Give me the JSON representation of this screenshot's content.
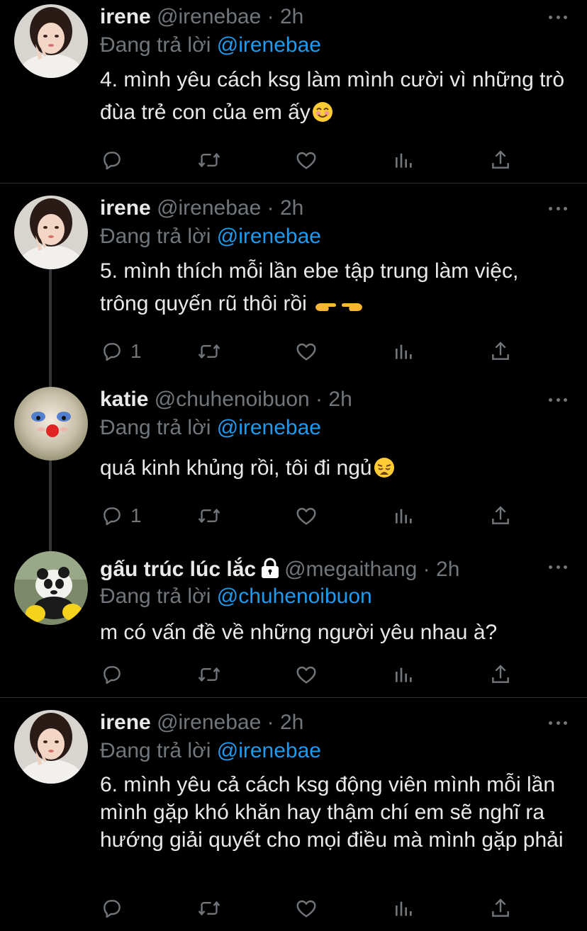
{
  "reply_prefix": "Đang trả lời",
  "tweets": [
    {
      "name": "irene",
      "handle": "@irenebae",
      "time": "2h",
      "reply_to": "@irenebae",
      "text": "4. mình yêu cách ksg làm mình cười vì những trò đùa trẻ con của em ấy",
      "emoji": "smiling-face-icon",
      "reply_count": "",
      "avatar": "irene-avatar"
    },
    {
      "name": "irene",
      "handle": "@irenebae",
      "time": "2h",
      "reply_to": "@irenebae",
      "text": "5. mình thích mỗi lần ebe tập trung làm việc, trông quyến rũ thôi rồi",
      "emoji": "pointing-hands-icon",
      "reply_count": "1",
      "avatar": "irene-avatar"
    },
    {
      "name": "katie",
      "handle": "@chuhenoibuon",
      "time": "2h",
      "reply_to": "@irenebae",
      "text": "quá kinh khủng rồi, tôi đi ngủ",
      "emoji": "weary-face-icon",
      "reply_count": "1",
      "avatar": "clown-dog-avatar"
    },
    {
      "name": "gấu trúc lúc lắc",
      "handle": "@megaithang",
      "time": "2h",
      "reply_to": "@chuhenoibuon",
      "text": "m có vấn đề về những người yêu nhau à?",
      "emoji": "",
      "reply_count": "",
      "avatar": "panda-avatar",
      "protected": true
    },
    {
      "name": "irene",
      "handle": "@irenebae",
      "time": "2h",
      "reply_to": "@irenebae",
      "text": "6. mình yêu cả cách ksg động viên mình mỗi lần mình gặp khó khăn hay thậm chí em sẽ nghĩ ra hướng giải quyết cho mọi điều mà mình gặp phải",
      "emoji": "",
      "reply_count": "",
      "avatar": "irene-avatar"
    }
  ],
  "colors": {
    "background": "#000000",
    "text": "#e7e9ea",
    "secondary": "#71767b",
    "accent": "#1d9bf0",
    "divider": "#2f3336"
  }
}
